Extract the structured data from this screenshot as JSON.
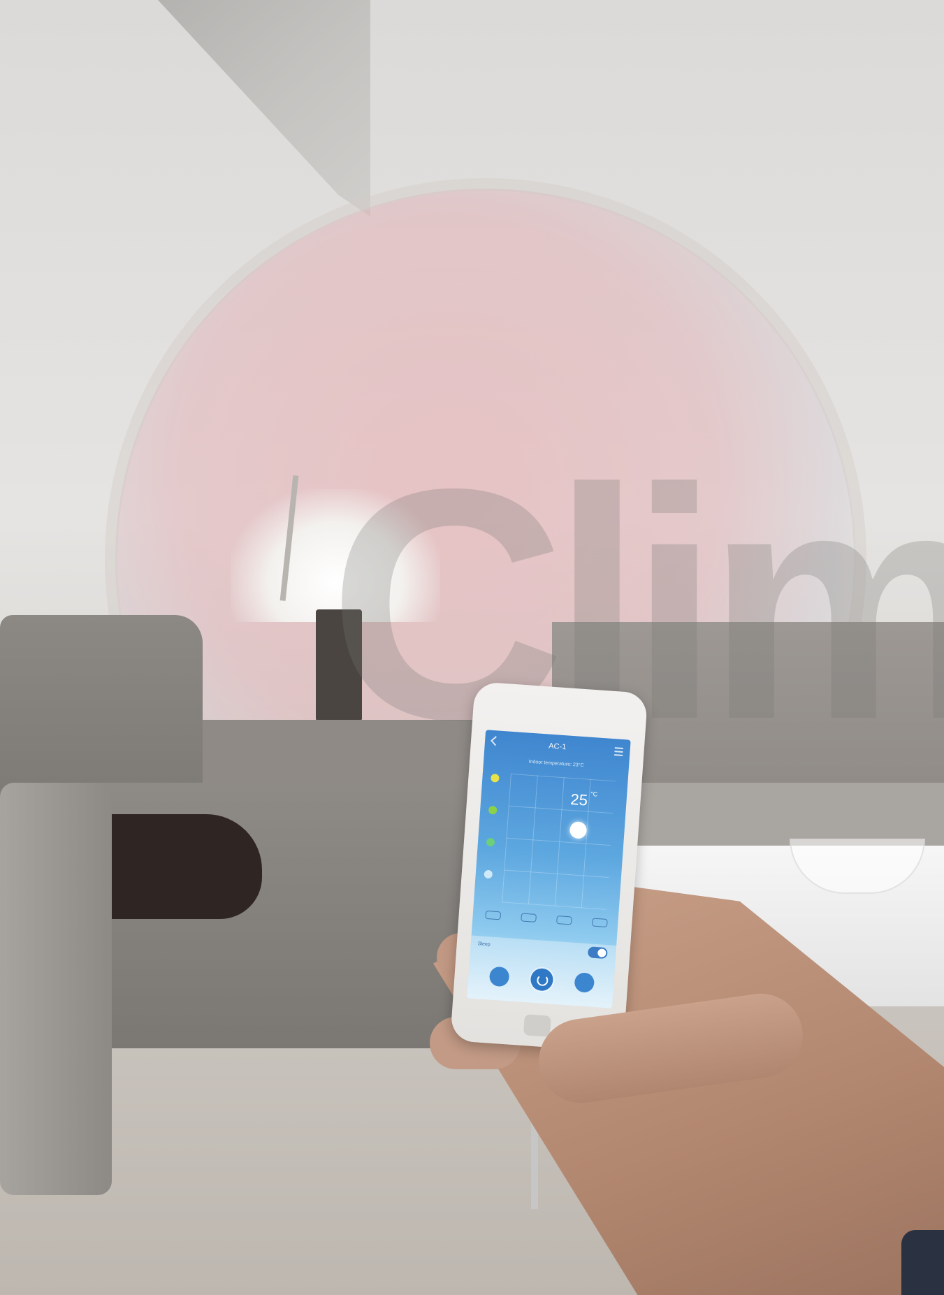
{
  "watermark": {
    "word": "Clima"
  },
  "app": {
    "device_name": "AC-1",
    "subtitle": "Indoor temperature: 23°C",
    "temperature": "25",
    "temperature_unit": "°C",
    "toggle_label": "Sleep",
    "toggle_on": true
  },
  "colors": {
    "accent": "#3d7cc5",
    "mode_dots": [
      "#e8e34a",
      "#8bd24a",
      "#6ccf7a",
      "#cfe9f7"
    ]
  }
}
